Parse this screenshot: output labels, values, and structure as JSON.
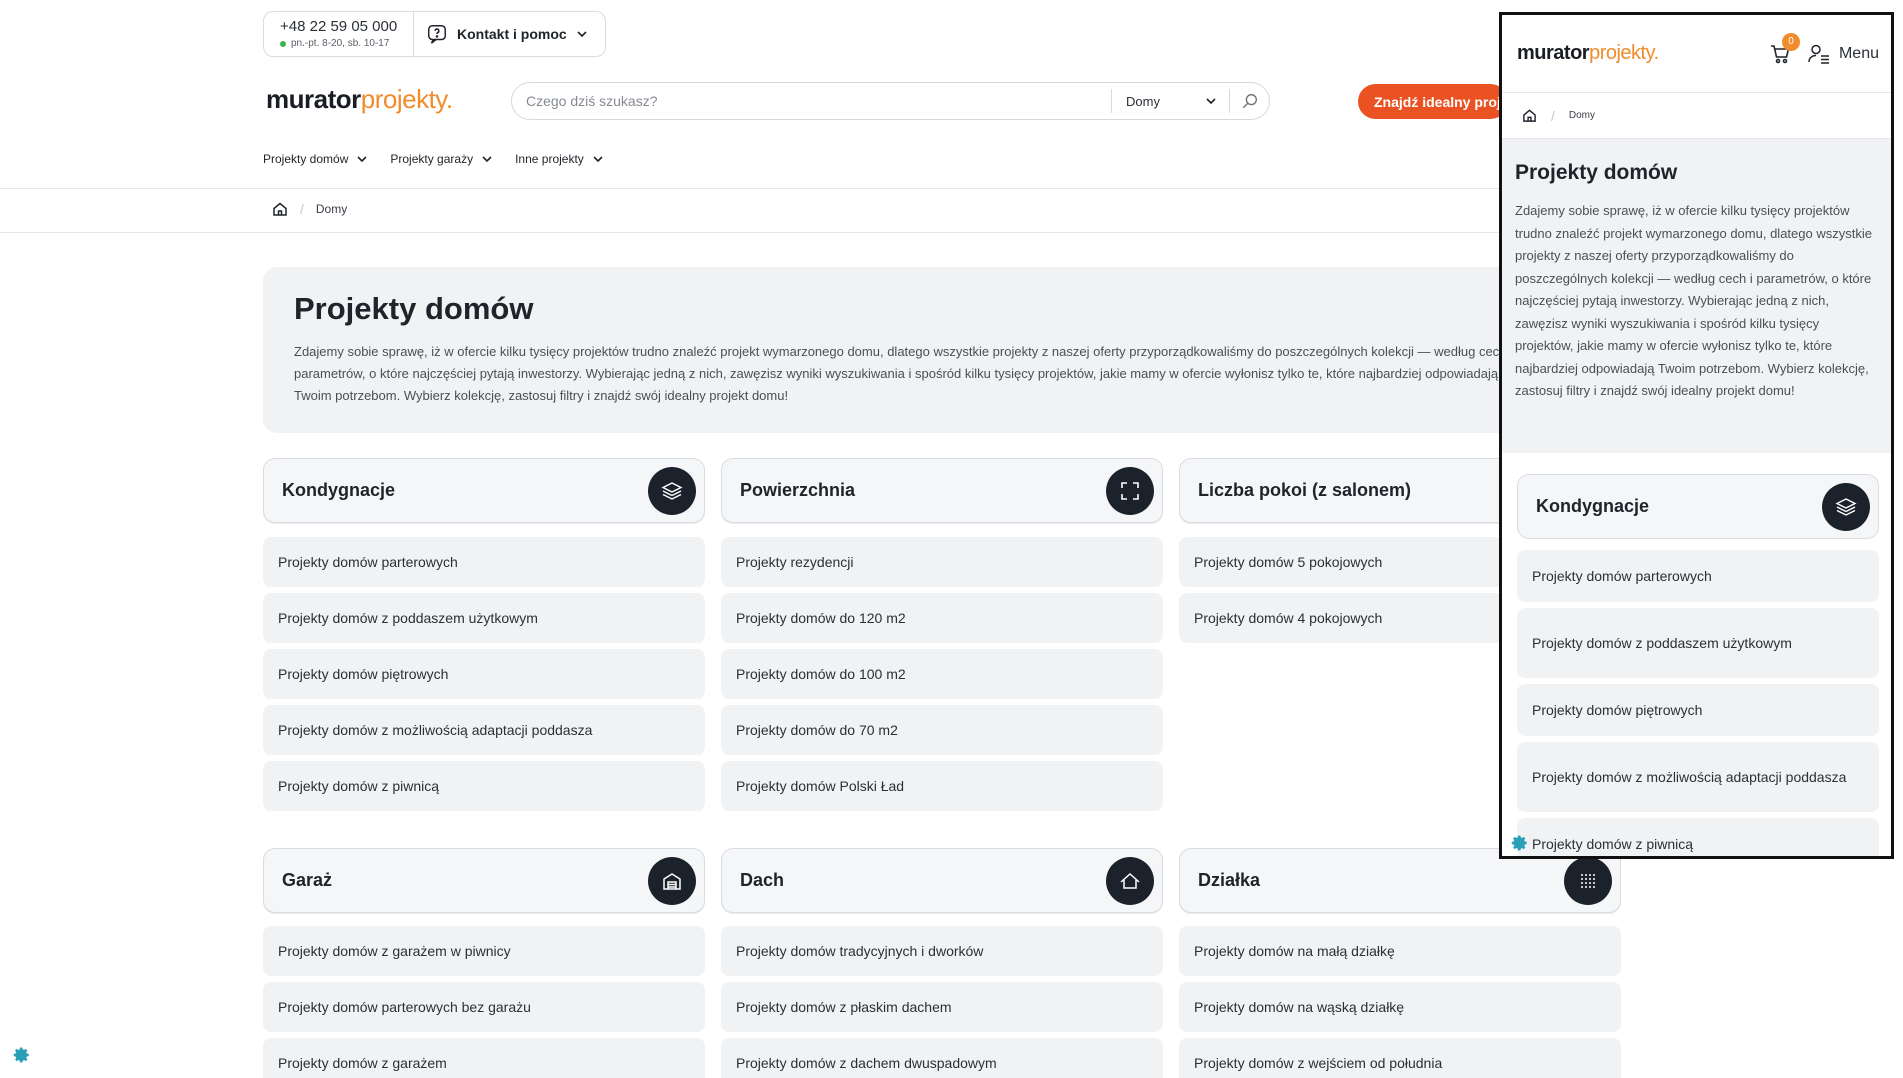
{
  "contact": {
    "phone": "+48 22 59 05 000",
    "hours": "pn.-pt. 8-20, sb. 10-17",
    "help_label": "Kontakt i pomoc"
  },
  "logo": {
    "part1": "murator",
    "part2": "projekty."
  },
  "search": {
    "placeholder": "Czego dziś szukasz?",
    "scope": "Domy"
  },
  "cta_label": "Znajdź idealny projekt",
  "nav": [
    "Projekty domów",
    "Projekty garaży",
    "Inne projekty"
  ],
  "breadcrumb": {
    "current": "Domy"
  },
  "intro": {
    "title": "Projekty domów",
    "text": "Zdajemy sobie sprawę, iż w ofercie kilku tysięcy projektów trudno znaleźć projekt wymarzonego domu, dlatego wszystkie projekty z naszej oferty przyporządkowaliśmy do poszczególnych kolekcji — według cech i parametrów, o które najczęściej pytają inwestorzy. Wybierając jedną z nich, zawęzisz wyniki wyszukiwania i spośród kilku tysięcy projektów, jakie mamy w ofercie wyłonisz tylko te, które najbardziej odpowiadają Twoim potrzebom. Wybierz kolekcję, zastosuj filtry i znajdź swój idealny projekt domu!"
  },
  "categories": [
    {
      "title": "Kondygnacje",
      "icon": "layers-icon",
      "links": [
        "Projekty domów parterowych",
        "Projekty domów z poddaszem użytkowym",
        "Projekty domów piętrowych",
        "Projekty domów z możliwością adaptacji poddasza",
        "Projekty domów z piwnicą"
      ]
    },
    {
      "title": "Powierzchnia",
      "icon": "expand-icon",
      "links": [
        "Projekty rezydencji",
        "Projekty domów do 120 m2",
        "Projekty domów do 100 m2",
        "Projekty domów do 70 m2",
        "Projekty domów Polski Ład"
      ]
    },
    {
      "title": "Liczba pokoi (z salonem)",
      "icon": "rooms-icon",
      "links": [
        "Projekty domów 5 pokojowych",
        "Projekty domów 4 pokojowych"
      ]
    },
    {
      "title": "Garaż",
      "icon": "garage-icon",
      "links": [
        "Projekty domów z garażem w piwnicy",
        "Projekty domów parterowych bez garażu",
        "Projekty domów z garażem"
      ]
    },
    {
      "title": "Dach",
      "icon": "roof-icon",
      "links": [
        "Projekty domów tradycyjnych i dworków",
        "Projekty domów z płaskim dachem",
        "Projekty domów z dachem dwuspadowym"
      ]
    },
    {
      "title": "Działka",
      "icon": "grid-dots-icon",
      "links": [
        "Projekty domów na małą działkę",
        "Projekty domów na wąską działkę",
        "Projekty domów z wejściem od południa"
      ]
    }
  ],
  "mobile": {
    "cart_count": "0",
    "menu_label": "Menu",
    "crumb": "Domy",
    "links": [
      "Projekty domów parterowych",
      "Projekty domów z poddaszem użytkowym",
      "Projekty domów piętrowych",
      "Projekty domów z możliwością adaptacji poddasza",
      "Projekty domów z piwnicą"
    ]
  },
  "colors": {
    "accent_orange": "#f08c2c",
    "cta_red": "#ea5223",
    "icon_dark": "#1c222b",
    "card_bg": "#f1f2f4",
    "gear_teal": "#2a9fb5"
  }
}
